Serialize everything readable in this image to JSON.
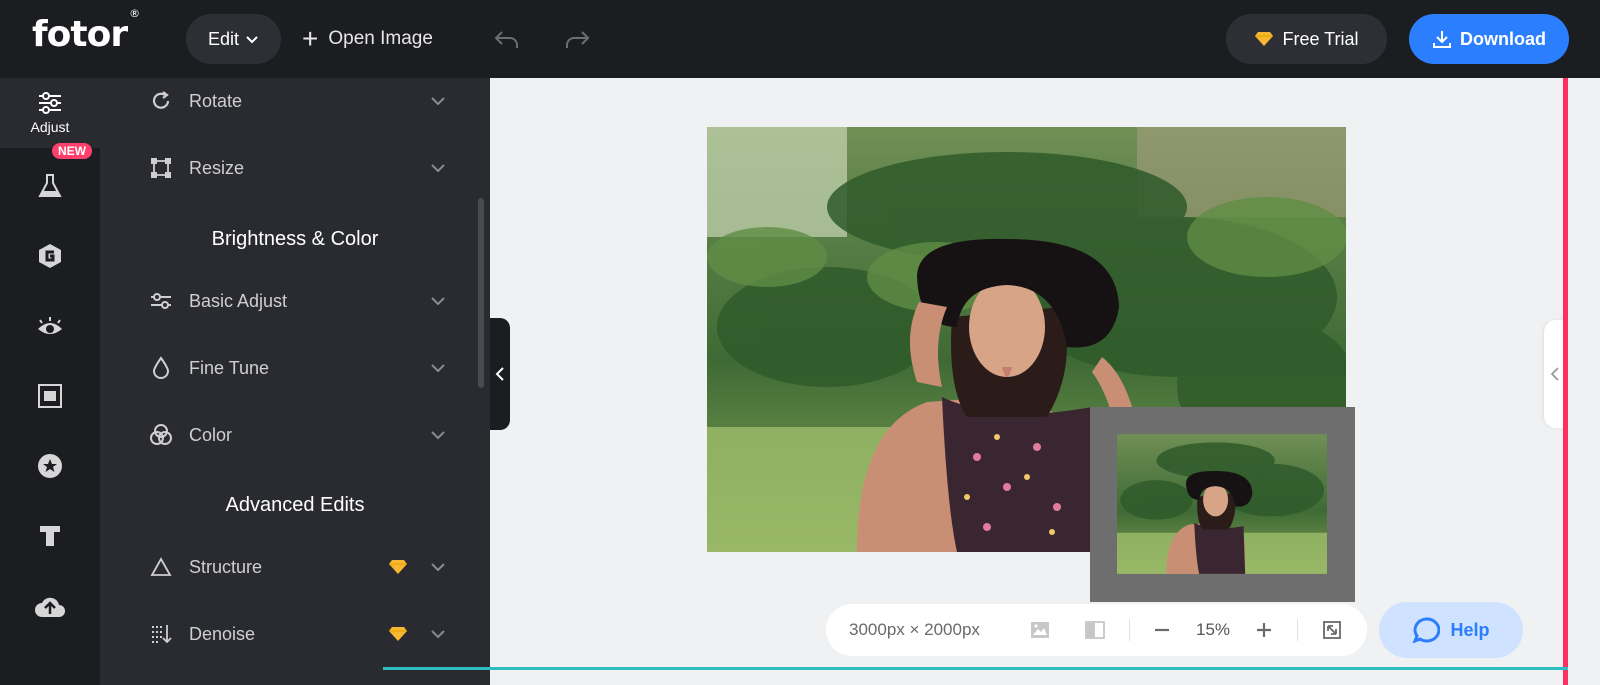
{
  "header": {
    "logo_text": "fotor",
    "logo_mark": "®",
    "edit_label": "Edit",
    "open_image_label": "Open Image",
    "free_trial_label": "Free Trial",
    "download_label": "Download"
  },
  "rail": {
    "adjust_label": "Adjust",
    "new_badge": "NEW",
    "icons": [
      "sliders-icon",
      "flask-icon",
      "ai-g-icon",
      "eye-icon",
      "frame-icon",
      "star-badge-icon",
      "text-icon",
      "cloud-upload-icon"
    ]
  },
  "panel": {
    "rows_top": [
      {
        "label": "Rotate",
        "icon": "rotate-icon"
      },
      {
        "label": "Resize",
        "icon": "resize-icon"
      }
    ],
    "section_brightness": "Brightness & Color",
    "rows_brightness": [
      {
        "label": "Basic Adjust",
        "icon": "sliders-icon"
      },
      {
        "label": "Fine Tune",
        "icon": "drop-icon"
      },
      {
        "label": "Color",
        "icon": "color-circles-icon"
      }
    ],
    "section_advanced": "Advanced Edits",
    "rows_advanced": [
      {
        "label": "Structure",
        "icon": "triangle-icon",
        "premium": true
      },
      {
        "label": "Denoise",
        "icon": "denoise-icon",
        "premium": true
      }
    ]
  },
  "canvas": {
    "dimensions": "3000px × 2000px",
    "zoom": "15%"
  },
  "help_label": "Help",
  "colors": {
    "topbar": "#1c1d21",
    "panel": "#2a2b30",
    "accent_blue": "#2b7fff",
    "new_badge": "#ff3f6c",
    "premium_gold": "#f7b731"
  }
}
